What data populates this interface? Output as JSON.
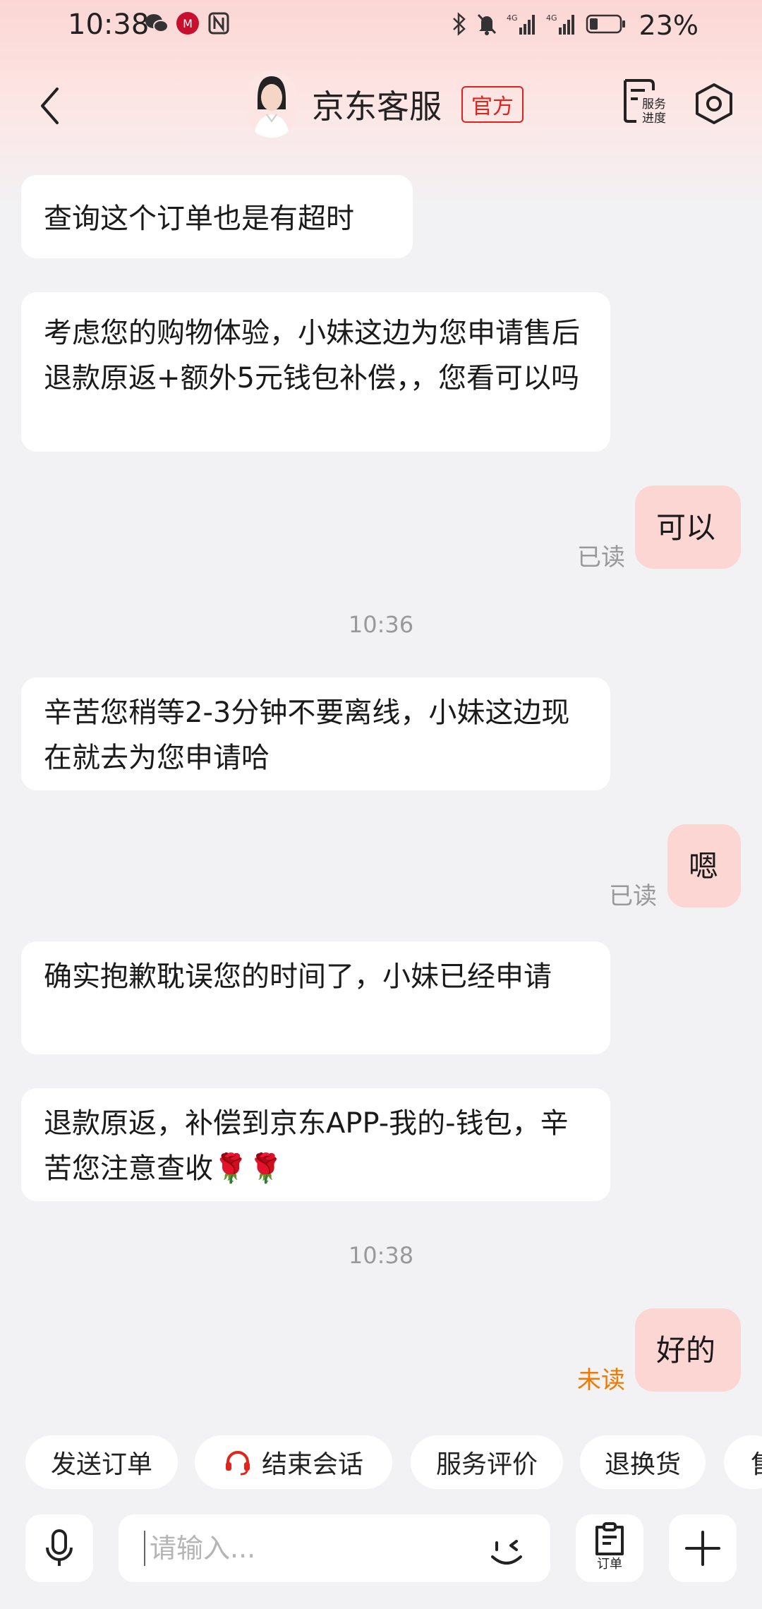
{
  "status_bar": {
    "time": "10:38",
    "network_1": "4G",
    "network_2": "4G",
    "battery_pct": "23%"
  },
  "header": {
    "title": "京东客服",
    "badge": "官方",
    "service_progress_label": "服务进度"
  },
  "messages": [
    {
      "from": "agent",
      "text": "查询这个订单也是有超时"
    },
    {
      "from": "agent",
      "text": "考虑您的购物体验，小妹这边为您申请售后退款原返+额外5元钱包补偿，，您看可以吗"
    },
    {
      "from": "user",
      "text": "可以",
      "status": "已读"
    },
    {
      "type": "time",
      "text": "10:36"
    },
    {
      "from": "agent",
      "text": "辛苦您稍等2-3分钟不要离线，小妹这边现在就去为您申请哈"
    },
    {
      "from": "user",
      "text": "嗯",
      "status": "已读"
    },
    {
      "from": "agent",
      "text": "确实抱歉耽误您的时间了，小妹已经申请"
    },
    {
      "from": "agent",
      "text": "退款原返，补偿到京东APP-我的-钱包，辛苦您注意查收🌹🌹"
    },
    {
      "type": "time",
      "text": "10:38"
    },
    {
      "from": "user",
      "text": "好的",
      "status": "未读"
    }
  ],
  "quick_actions": [
    "发送订单",
    "结束会话",
    "服务评价",
    "退换货",
    "售"
  ],
  "input": {
    "placeholder": "请输入...",
    "order_label": "订单"
  },
  "colors": {
    "accent": "#e2231a",
    "user_bubble": "#fcd6d3",
    "unread": "#f07a00"
  }
}
